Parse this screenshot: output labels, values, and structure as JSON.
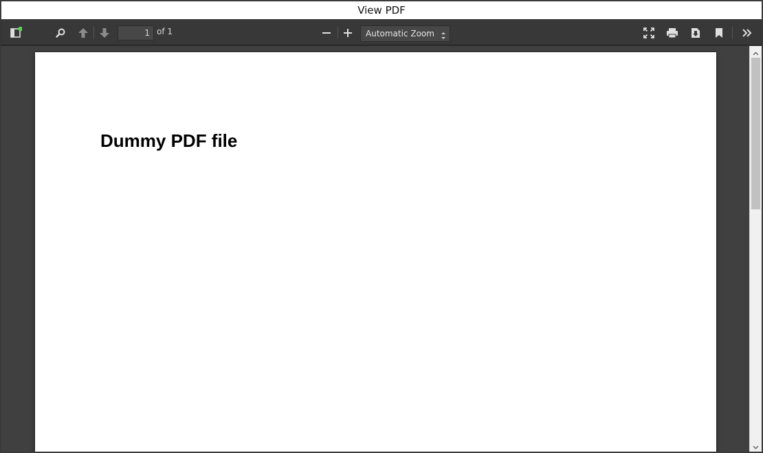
{
  "window": {
    "title": "View PDF"
  },
  "toolbar": {
    "page_number": "1",
    "page_count": "of 1",
    "zoom": "Automatic Zoom",
    "icons": {
      "sidebar": "sidebar-toggle-icon",
      "search": "search-icon",
      "previous": "arrow-up-icon",
      "next": "arrow-down-icon",
      "zoom_out": "minus-icon",
      "zoom_in": "plus-icon",
      "presentation": "fullscreen-icon",
      "print": "printer-icon",
      "download": "download-icon",
      "bookmark": "bookmark-icon",
      "tools": "double-chevron-right-icon"
    },
    "notification_color": "#5fd35a"
  },
  "document": {
    "pages": [
      {
        "title": "Dummy PDF file"
      }
    ]
  }
}
